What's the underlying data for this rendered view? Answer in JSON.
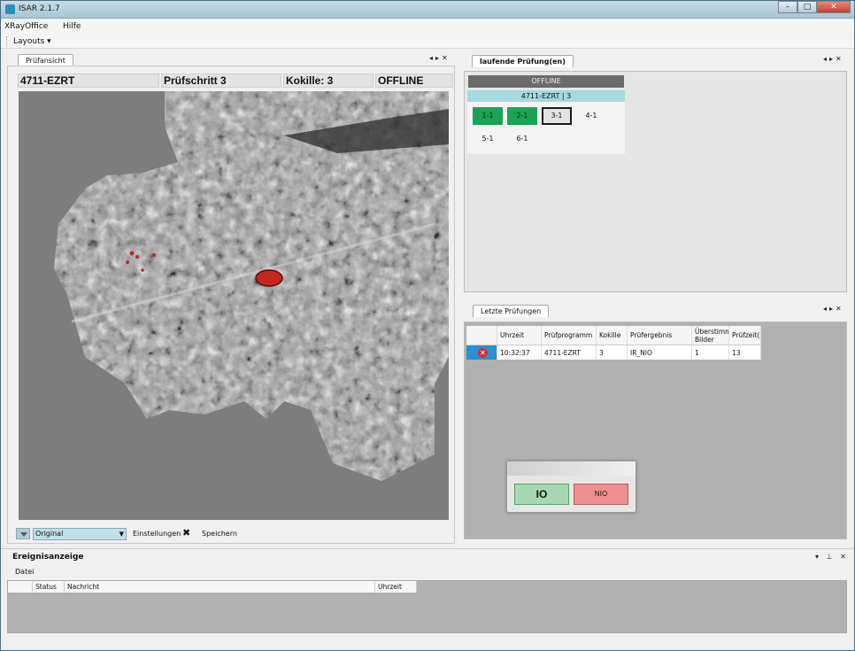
{
  "window": {
    "title": "ISAR 2.1.7"
  },
  "menu": {
    "items": [
      "XRayOffice",
      "Hilfe"
    ]
  },
  "toolbar": {
    "layouts_label": "Layouts"
  },
  "pruefansicht": {
    "tab_label": "Prüfansicht",
    "info": {
      "part": "4711-EZRT",
      "step": "Prüfschritt 3",
      "kokille": "Kokille: 3",
      "status": "OFFLINE"
    },
    "view_mode": "Original",
    "settings_label": "Einstellungen",
    "save_label": "Speichern"
  },
  "laufende": {
    "tab_label": "laufende Prüfung(en)",
    "status": "OFFLINE",
    "job_title": "4711-EZRT | 3",
    "steps": [
      {
        "label": "1-1",
        "state": "ok"
      },
      {
        "label": "2-1",
        "state": "ok"
      },
      {
        "label": "3-1",
        "state": "current"
      },
      {
        "label": "4-1",
        "state": "pending"
      },
      {
        "label": "5-1",
        "state": "pending"
      },
      {
        "label": "6-1",
        "state": "pending"
      }
    ]
  },
  "letzte": {
    "tab_label": "Letzte Prüfungen",
    "columns": [
      "Uhrzeit",
      "Prüfprogramm",
      "Kokille",
      "Prüfergebnis",
      "Überstimmte Bilder",
      "Prüfzeit(s"
    ],
    "rows": [
      {
        "icon": "error-icon",
        "uhrzeit": "10:32:37",
        "programm": "4711-EZRT",
        "kokille": "3",
        "ergebnis": "IR_NIO",
        "bilder": "1",
        "zeit": "13"
      }
    ]
  },
  "decision": {
    "io_label": "IO",
    "nio_label": "NIO"
  },
  "events": {
    "title": "Ereignisanzeige",
    "menu_label": "Datei",
    "columns": [
      "Status",
      "Nachricht",
      "Uhrzeit"
    ]
  },
  "colors": {
    "ok": "#1aa352",
    "highlight": "#a6d9de",
    "io": "#a7d8b4",
    "nio": "#ef8f8f",
    "defect": "#c0281e"
  }
}
